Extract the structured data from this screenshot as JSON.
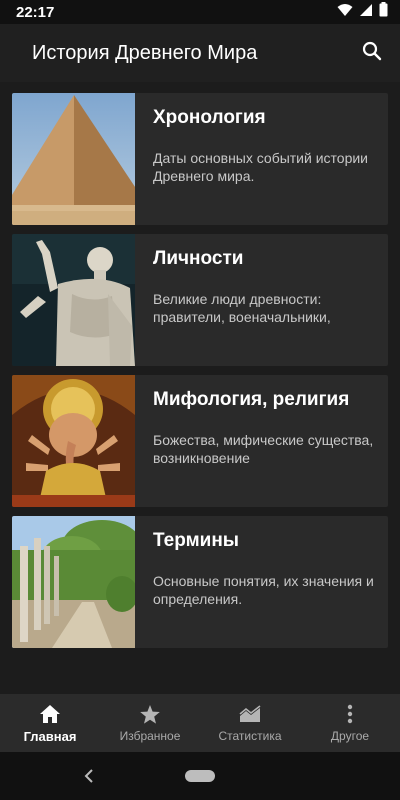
{
  "status_bar": {
    "time": "22:17"
  },
  "app_bar": {
    "title": "История Древнего Мира"
  },
  "cards": [
    {
      "title": "Хронология",
      "description": "Даты основных событий истории Древнего мира."
    },
    {
      "title": "Личности",
      "description": "Великие люди древности: правители, военачальники,"
    },
    {
      "title": "Мифология, религия",
      "description": "Божества, мифические существа, возникновение"
    },
    {
      "title": "Термины",
      "description": "Основные понятия, их значения и определения."
    }
  ],
  "bottom_nav": {
    "items": [
      {
        "label": "Главная",
        "icon": "home-icon",
        "active": true
      },
      {
        "label": "Избранное",
        "icon": "star-icon",
        "active": false
      },
      {
        "label": "Статистика",
        "icon": "chart-icon",
        "active": false
      },
      {
        "label": "Другое",
        "icon": "more-vertical-icon",
        "active": false
      }
    ]
  },
  "colors": {
    "background": "#1c1c1c",
    "card": "#2a2a2a",
    "app_bar": "#202020",
    "bottom_nav": "#2b2b2b"
  }
}
